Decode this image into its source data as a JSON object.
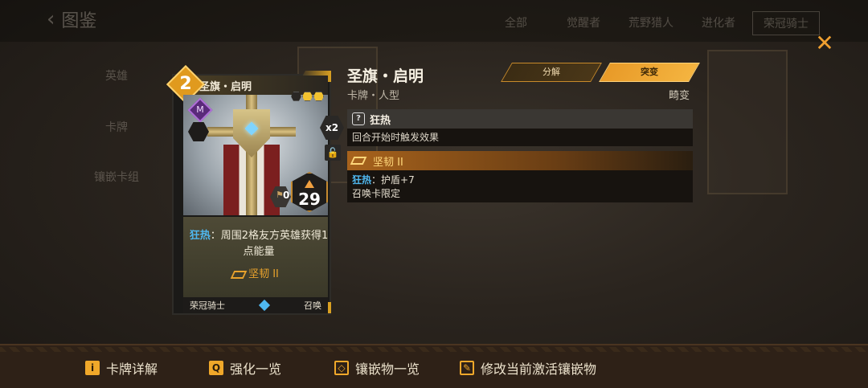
{
  "background": {
    "back_title": "图鉴",
    "tabs": [
      "全部",
      "觉醒者",
      "荒野猎人",
      "进化者",
      "荣冠骑士"
    ],
    "side_items": [
      "英雄",
      "卡牌",
      "镶嵌卡组"
    ]
  },
  "card": {
    "cost": "2",
    "name": "圣旗・启明",
    "type_glyph": "M",
    "copies": "x2",
    "lock_icon": "lock-icon",
    "small_stat": "0",
    "power": "29",
    "desc_keyword": "狂热",
    "desc_text": "：周围2格友方英雄获得1点能量",
    "tag": "坚韧 II",
    "faction": "荣冠骑士",
    "kind": "召唤"
  },
  "info": {
    "title": "圣旗・启明",
    "subtitle": "卡牌・人型",
    "rarity": "畸变",
    "decompose_label": "分解",
    "breakthrough_label": "突变",
    "effect1": {
      "icon_glyph": "?",
      "name": "狂热",
      "desc": "回合开始时触发效果"
    },
    "effect2": {
      "name": "坚韧 II",
      "keyword": "狂热",
      "line1_rest": "：护盾+7",
      "line2": "召唤卡限定"
    }
  },
  "bottom": {
    "items": [
      {
        "icon": "i",
        "label": "卡牌详解"
      },
      {
        "icon": "Q",
        "label": "强化一览"
      },
      {
        "icon": "◇",
        "label": "镶嵌物一览"
      },
      {
        "icon": "✎",
        "label": "修改当前激活镶嵌物"
      }
    ]
  },
  "colors": {
    "accent": "#f0a82a",
    "keyword": "#4fb8f0",
    "tag": "#e8a22c"
  }
}
